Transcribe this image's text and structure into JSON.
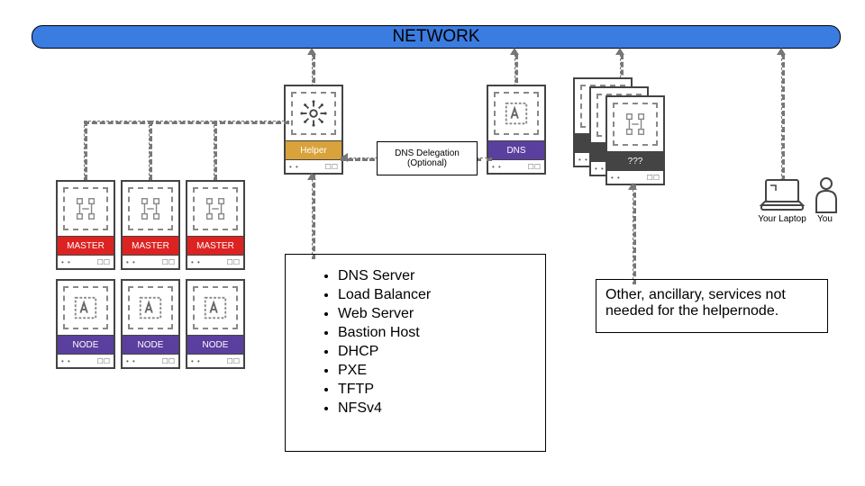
{
  "network": {
    "title": "NETWORK"
  },
  "helper": {
    "label": "Helper"
  },
  "dns": {
    "label": "DNS"
  },
  "unknown": {
    "label": "???"
  },
  "masters": {
    "label": "MASTER"
  },
  "nodes": {
    "label": "NODE"
  },
  "dns_delegation": {
    "line1": "DNS Delegation",
    "line2": "(Optional)"
  },
  "services": {
    "items": [
      "DNS Server",
      "Load Balancer",
      "Web Server",
      "Bastion Host",
      "DHCP",
      "PXE",
      "TFTP",
      "NFSv4"
    ]
  },
  "ancillary": {
    "text": "Other, ancillary, services not needed for the helpernode."
  },
  "laptop": {
    "caption": "Your Laptop"
  },
  "you": {
    "caption": "You"
  }
}
